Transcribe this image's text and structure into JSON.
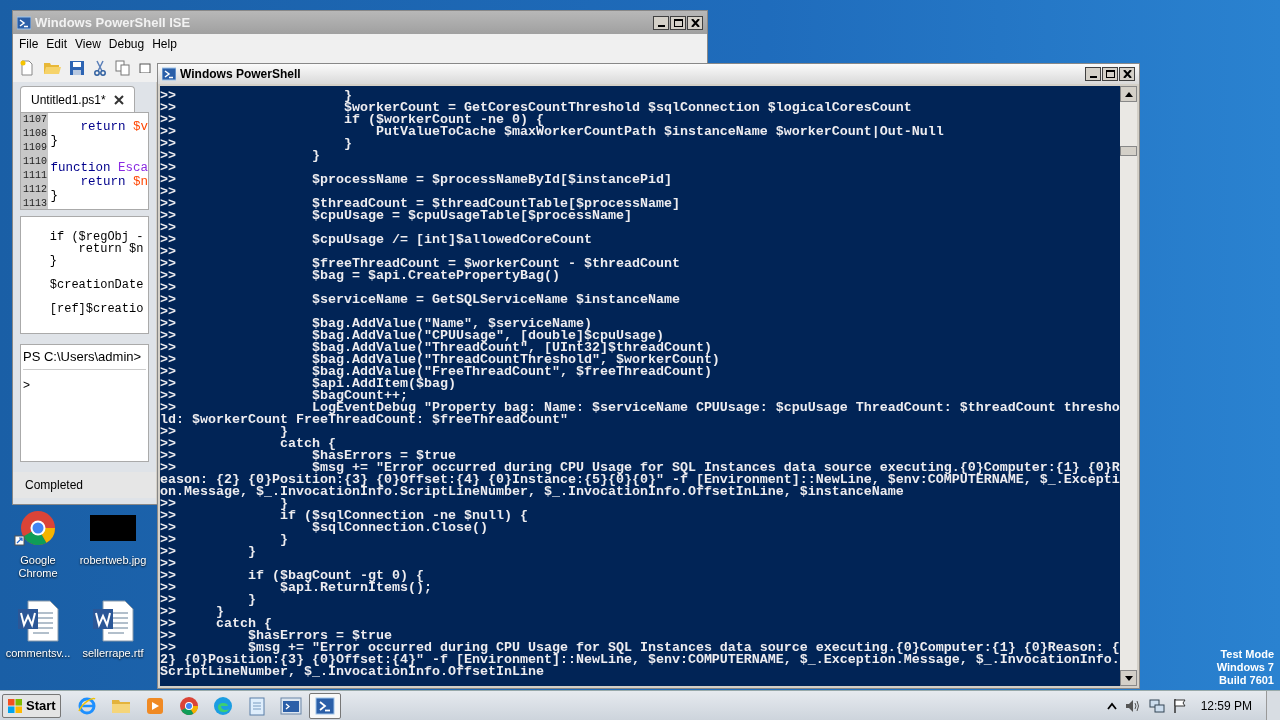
{
  "ise_window": {
    "title": "Windows PowerShell ISE",
    "menu": [
      "File",
      "Edit",
      "View",
      "Debug",
      "Help"
    ],
    "toolbar": [
      {
        "kind": "new"
      },
      {
        "kind": "open"
      },
      {
        "kind": "save"
      },
      {
        "kind": "cut"
      },
      {
        "kind": "copy"
      },
      {
        "kind": "paste"
      }
    ],
    "tab": {
      "label": "Untitled1.ps1*",
      "selected": true
    },
    "editor_lines": [
      {
        "number": "1107",
        "tokens": [
          {
            "text": "    return",
            "kind": "keyword"
          },
          {
            "text": " $v",
            "kind": "variable"
          }
        ]
      },
      {
        "number": "1108",
        "tokens": [
          {
            "text": "}",
            "kind": "plain"
          }
        ]
      },
      {
        "number": "1109"
      },
      {
        "number": "1110",
        "tokens": [
          {
            "text": "function",
            "kind": "keyword"
          },
          {
            "text": " Esca",
            "kind": "name"
          }
        ]
      },
      {
        "number": "1111",
        "tokens": [
          {
            "text": "    return",
            "kind": "keyword"
          },
          {
            "text": " $n",
            "kind": "variable"
          }
        ]
      },
      {
        "number": "1112",
        "tokens": [
          {
            "text": "}",
            "kind": "plain"
          }
        ]
      },
      {
        "number": "1113"
      }
    ],
    "script_blocks": [
      [
        "    if ($regObj -",
        "        return $n",
        "    }"
      ],
      [
        "    $creationDate"
      ],
      [
        "    [ref]$creatio"
      ]
    ],
    "console_prompt": "PS C:\\Users\\admin>",
    "console_input": ">",
    "status": "Completed"
  },
  "console_window": {
    "title": "Windows PowerShell",
    "lines": [
      ">>                     }",
      ">>                     $workerCount = GetCoresCountThreshold $sqlConnection $logicalCoresCount",
      ">>                     if ($workerCount -ne 0) {",
      ">>                         PutValueToCache $maxWorkerCountPath $instanceName $workerCount|Out-Null",
      ">>                     }",
      ">>                 }",
      ">>",
      ">>                 $processName = $processNameById[$instancePid]",
      ">>",
      ">>                 $threadCount = $threadCountTable[$processName]",
      ">>                 $cpuUsage = $cpuUsageTable[$processName]",
      ">>",
      ">>                 $cpuUsage /= [int]$allowedCoreCount",
      ">>",
      ">>                 $freeThreadCount = $workerCount - $threadCount",
      ">>                 $bag = $api.CreatePropertyBag()",
      ">>",
      ">>                 $serviceName = GetSQLServiceName $instanceName",
      ">>",
      ">>                 $bag.AddValue(\"Name\", $serviceName)",
      ">>                 $bag.AddValue(\"CPUUsage\", [double]$cpuUsage)",
      ">>                 $bag.AddValue(\"ThreadCount\", [UInt32]$threadCount)",
      ">>                 $bag.AddValue(\"ThreadCountThreshold\", $workerCount)",
      ">>                 $bag.AddValue(\"FreeThreadCount\", $freeThreadCount)",
      ">>                 $api.AddItem($bag)",
      ">>                 $bagCount++;",
      ">>                 LogEventDebug \"Property bag: Name: $serviceName CPUUsage: $cpuUsage ThreadCount: $threadCount thresho",
      "ld: $workerCount FreeThreadCount: $freeThreadCount\"",
      ">>             }",
      ">>             catch {",
      ">>                 $hasErrors = $true",
      ">>                 $msg += \"Error occurred during CPU Usage for SQL Instances data source executing.{0}Computer:{1} {0}R",
      "eason: {2} {0}Position:{3} {0}Offset:{4} {0}Instance:{5}{0}{0}\" -f [Environment]::NewLine, $env:COMPUTERNAME, $_.Excepti",
      "on.Message, $_.InvocationInfo.ScriptLineNumber, $_.InvocationInfo.OffsetInLine, $instanceName",
      ">>             }",
      ">>             if ($sqlConnection -ne $null) {",
      ">>                 $sqlConnection.Close()",
      ">>             }",
      ">>         }",
      ">>",
      ">>         if ($bagCount -gt 0) {",
      ">>             $api.ReturnItems();",
      ">>         }",
      ">>     }",
      ">>     catch {",
      ">>         $hasErrors = $true",
      ">>         $msg += \"Error occurred during CPU Usage for SQL Instances data source executing.{0}Computer:{1} {0}Reason: {",
      "2} {0}Position:{3} {0}Offset:{4}\" -f [Environment]::NewLine, $env:COMPUTERNAME, $_.Exception.Message, $_.InvocationInfo.",
      "ScriptLineNumber, $_.InvocationInfo.OffsetInLine"
    ]
  },
  "desktop_icons": [
    {
      "label": "Google Chrome",
      "kind": "chrome"
    },
    {
      "label": "robertweb.jpg",
      "kind": "image"
    },
    {
      "label": "commentsv...",
      "kind": "word"
    },
    {
      "label": "sellerrape.rtf",
      "kind": "word"
    }
  ],
  "system_notice": [
    "Test Mode",
    "Windows 7",
    "Build 7601"
  ],
  "taskbar": {
    "start": "Start",
    "apps": [
      {
        "kind": "ie",
        "selected": false
      },
      {
        "kind": "folder",
        "selected": false
      },
      {
        "kind": "media",
        "selected": false
      },
      {
        "kind": "chrome",
        "selected": false
      },
      {
        "kind": "edge",
        "selected": false
      },
      {
        "kind": "notepad",
        "selected": false
      },
      {
        "kind": "ise",
        "selected": false
      },
      {
        "kind": "powershell",
        "selected": true
      }
    ],
    "tray": [
      {
        "kind": "chevron"
      },
      {
        "kind": "speaker"
      },
      {
        "kind": "network"
      },
      {
        "kind": "flag"
      }
    ],
    "clock": "12:59 PM"
  }
}
